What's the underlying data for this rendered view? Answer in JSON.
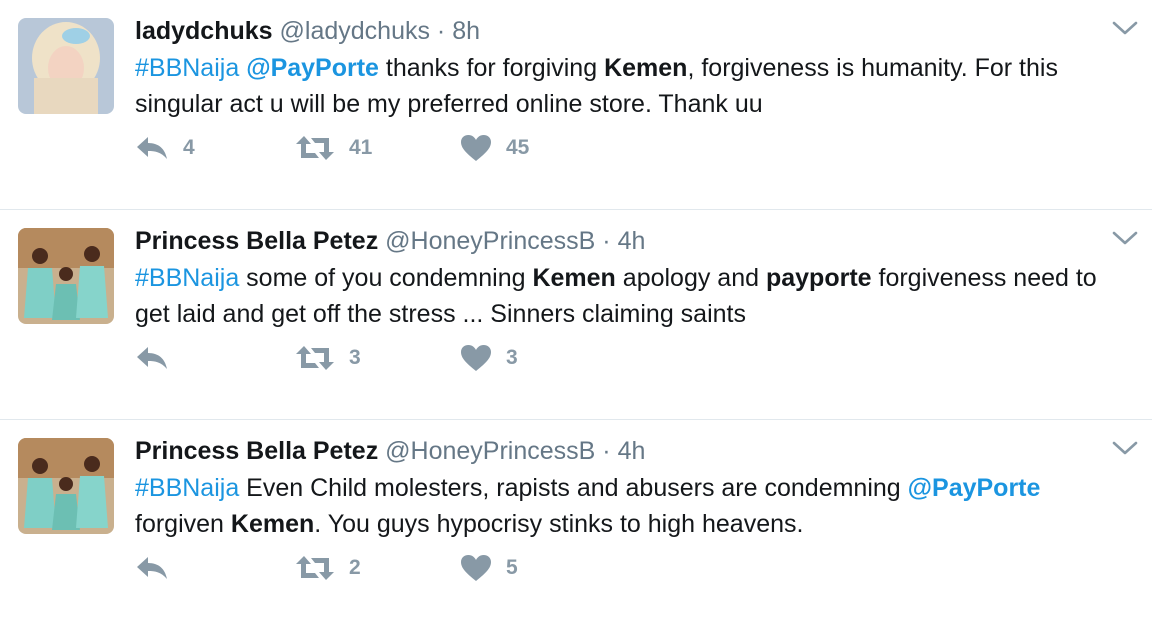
{
  "tweets": [
    {
      "name": "ladydchuks",
      "handle": "@ladydchuks",
      "time": "8h",
      "text": [
        {
          "t": "#BBNaija",
          "s": "tag"
        },
        {
          "t": " ",
          "s": ""
        },
        {
          "t": "@PayPorte",
          "s": "mention"
        },
        {
          "t": " thanks for forgiving ",
          "s": ""
        },
        {
          "t": "Kemen",
          "s": "bold"
        },
        {
          "t": ", forgiveness is humanity. For this singular act u will be my preferred online store. Thank uu",
          "s": ""
        }
      ],
      "reply_count": "4",
      "retweet_count": "41",
      "like_count": "45"
    },
    {
      "name": "Princess Bella Petez",
      "handle": "@HoneyPrincessB",
      "time": "4h",
      "text": [
        {
          "t": "#BBNaija",
          "s": "tag"
        },
        {
          "t": " some of you condemning ",
          "s": ""
        },
        {
          "t": "Kemen",
          "s": "bold"
        },
        {
          "t": " apology and ",
          "s": ""
        },
        {
          "t": "payporte",
          "s": "bold"
        },
        {
          "t": " forgiveness need to get laid and get off the stress ... Sinners claiming saints",
          "s": ""
        }
      ],
      "reply_count": "",
      "retweet_count": "3",
      "like_count": "3"
    },
    {
      "name": "Princess Bella Petez",
      "handle": "@HoneyPrincessB",
      "time": "4h",
      "text": [
        {
          "t": "#BBNaija",
          "s": "tag"
        },
        {
          "t": " Even Child molesters, rapists and abusers are condemning ",
          "s": ""
        },
        {
          "t": "@PayPorte",
          "s": "mention"
        },
        {
          "t": " forgiven ",
          "s": ""
        },
        {
          "t": "Kemen",
          "s": "bold"
        },
        {
          "t": ". You guys hypocrisy stinks to high heavens.",
          "s": ""
        }
      ],
      "reply_count": "",
      "retweet_count": "2",
      "like_count": "5"
    }
  ],
  "separator_dot": "·",
  "colors": {
    "link": "#1b95e0",
    "muted": "#657786",
    "icon": "#8899a6",
    "text": "#14171a",
    "divider": "#e1e8ed"
  },
  "icons": {
    "reply": "reply-icon",
    "retweet": "retweet-icon",
    "like": "heart-icon",
    "menu": "chevron-down-icon"
  }
}
